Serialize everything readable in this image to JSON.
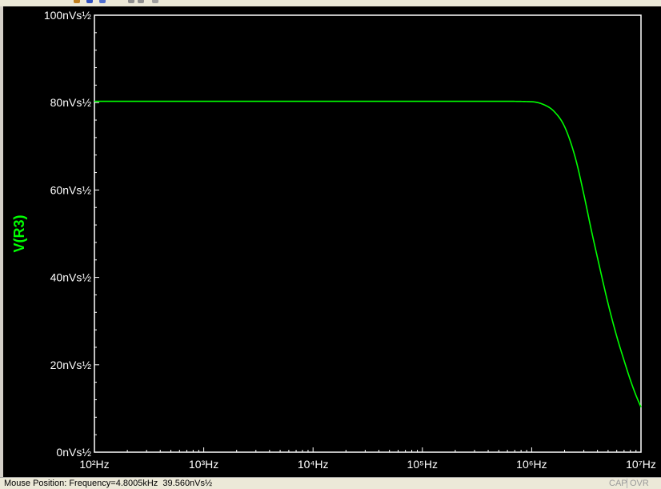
{
  "status_bar": {
    "mouse_position": "Mouse Position: Frequency=4.8005kHz  39.560nVs½",
    "cap": "CAP",
    "ovr": "OVR"
  },
  "colors": {
    "background": "#000000",
    "axes": "#ffffff",
    "trace": "#00ff00"
  },
  "chart_data": {
    "type": "line",
    "title": "",
    "xlabel": "",
    "ylabel": "V(R3)",
    "xscale": "log",
    "xlim": [
      100,
      10000000
    ],
    "ylim": [
      0,
      100
    ],
    "yunit": "nVs½",
    "x_tick_labels": [
      "10²Hz",
      "10³Hz",
      "10⁴Hz",
      "10⁵Hz",
      "10⁶Hz",
      "10⁷Hz"
    ],
    "y_tick_labels": [
      "0nVs½",
      "20nVs½",
      "40nVs½",
      "60nVs½",
      "80nVs½",
      "100nVs½"
    ],
    "grid": false,
    "series": [
      {
        "name": "V(R3)",
        "color": "#00ff00",
        "x": [
          100,
          1000,
          10000,
          100000,
          500000,
          1000000,
          1300000,
          1600000,
          2000000,
          2500000,
          3000000,
          3500000,
          4000000,
          5000000,
          6000000,
          7000000,
          8000000,
          9000000,
          10000000
        ],
        "y": [
          80.3,
          80.3,
          80.3,
          80.3,
          80.3,
          80.2,
          79.5,
          78.0,
          74.5,
          67.5,
          59.0,
          51.0,
          44.5,
          34.0,
          26.5,
          21.0,
          16.5,
          13.0,
          10.3
        ]
      }
    ]
  }
}
